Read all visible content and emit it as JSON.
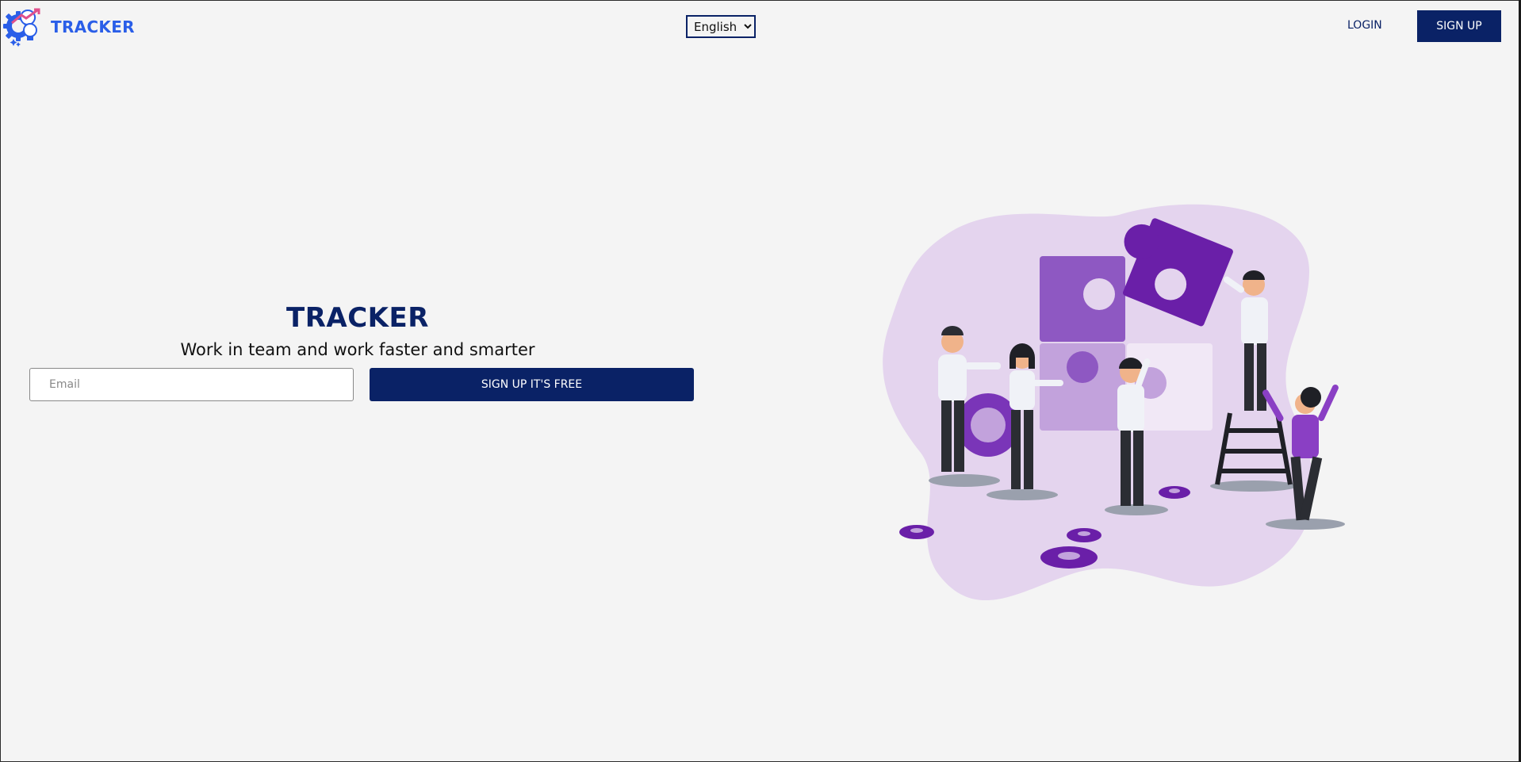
{
  "header": {
    "logo_text": "TRACKER",
    "language": {
      "selected": "English",
      "options": [
        "English"
      ]
    },
    "login_label": "LOGIN",
    "signup_label": "SIGN UP"
  },
  "hero": {
    "title": "TRACKER",
    "subtitle": "Work in team and work faster and smarter",
    "email_placeholder": "Email",
    "email_value": "",
    "cta_label": "SIGN UP IT'S FREE"
  },
  "colors": {
    "brand_blue": "#2a5ee8",
    "navy": "#0a2266",
    "background": "#f4f4f4",
    "purple": "#7a35b8",
    "lavender": "#e4d4ee"
  },
  "icons": {
    "logo": "gear-lightbulb-icon",
    "select_arrow": "chevron-down-icon"
  }
}
